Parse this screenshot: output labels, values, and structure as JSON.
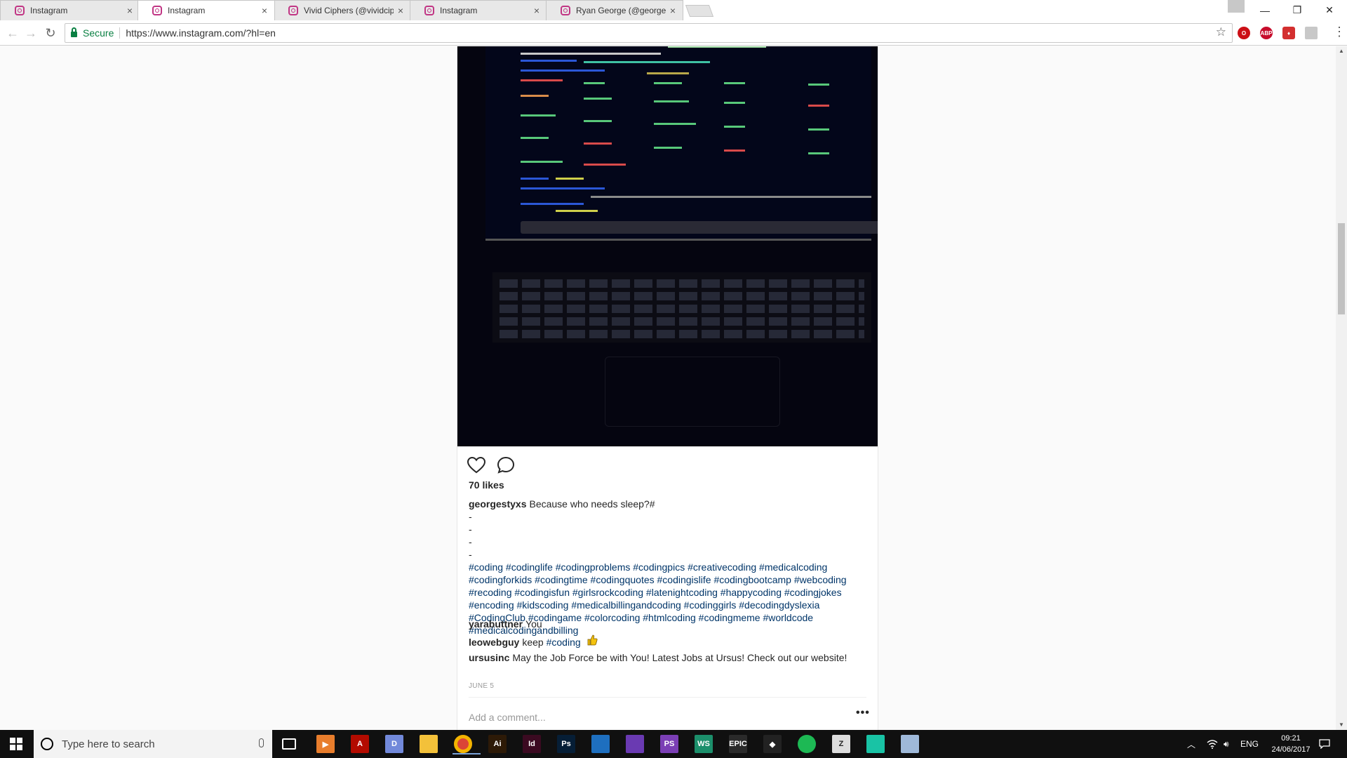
{
  "browser": {
    "tabs": [
      {
        "label": "Instagram",
        "active": false
      },
      {
        "label": "Instagram",
        "active": true
      },
      {
        "label": "Vivid Ciphers (@vividcip",
        "active": false
      },
      {
        "label": "Instagram",
        "active": false
      },
      {
        "label": "Ryan George (@george",
        "active": false
      }
    ],
    "close_glyph": "×",
    "secure_label": "Secure",
    "url": "https://www.instagram.com/?hl=en"
  },
  "post": {
    "likes": "70 likes",
    "caption": {
      "username": "georgestyxs",
      "text": "Because who needs sleep?#",
      "dashes": [
        "-",
        "-",
        "-",
        "-"
      ],
      "hashtags": "#coding #codinglife #codingproblems #codingpics #creativecoding #medicalcoding #codingforkids #codingtime #codingquotes #codingislife #codingbootcamp #webcoding #recoding #codingisfun #girlsrockcoding #latenightcoding #happycoding #codingjokes #encoding #kidscoding #medicalbillingandcoding #codinggirls #decodingdyslexia #CodingClub #codingame #colorcoding #htmlcoding #codingmeme #worldcode #medicalcodingandbilling"
    },
    "comments": [
      {
        "username": "yarabuttner",
        "text": "You",
        "tag": ""
      },
      {
        "username": "leowebguy",
        "text": "keep",
        "tag": "#coding"
      },
      {
        "username": "ursusinc",
        "text": "May the Job Force be with You! Latest Jobs at Ursus! Check out our website!",
        "tag": ""
      }
    ],
    "date": "JUNE 5",
    "add_comment_placeholder": "Add a comment...",
    "more_label": "•••"
  },
  "taskbar": {
    "search_placeholder": "Type here to search",
    "language": "ENG",
    "time": "09:21",
    "date": "24/06/2017",
    "pinned": [
      {
        "name": "task-view",
        "label": "",
        "color": "#101010"
      },
      {
        "name": "media-player",
        "label": "▶",
        "color": "#e87d2c"
      },
      {
        "name": "acrobat",
        "label": "A",
        "color": "#b30b00"
      },
      {
        "name": "discord",
        "label": "D",
        "color": "#7289da"
      },
      {
        "name": "file-explorer",
        "label": "",
        "color": "#f3c13a"
      },
      {
        "name": "chrome",
        "label": "",
        "color": "#db4437"
      },
      {
        "name": "illustrator",
        "label": "Ai",
        "color": "#2d1a07"
      },
      {
        "name": "indesign",
        "label": "Id",
        "color": "#3b0a21"
      },
      {
        "name": "photoshop",
        "label": "Ps",
        "color": "#061e36"
      },
      {
        "name": "vscode",
        "label": "",
        "color": "#1e6fbf"
      },
      {
        "name": "visual-studio",
        "label": "",
        "color": "#6a3ab2"
      },
      {
        "name": "phpstorm",
        "label": "PS",
        "color": "#7b3fb5"
      },
      {
        "name": "webstorm",
        "label": "WS",
        "color": "#1c8f6b"
      },
      {
        "name": "epic-games",
        "label": "EPIC",
        "color": "#2a2a2a"
      },
      {
        "name": "unity",
        "label": "◆",
        "color": "#222222"
      },
      {
        "name": "spotify",
        "label": "",
        "color": "#1db954"
      },
      {
        "name": "zbrush",
        "label": "Z",
        "color": "#dddddd"
      },
      {
        "name": "game-app",
        "label": "",
        "color": "#19c3a5"
      },
      {
        "name": "snipping-tool",
        "label": "",
        "color": "#9fb9d9"
      }
    ]
  },
  "colors": {
    "instagram_link": "#003569",
    "secure_green": "#0b8043",
    "taskbar_bg": "#101010"
  }
}
